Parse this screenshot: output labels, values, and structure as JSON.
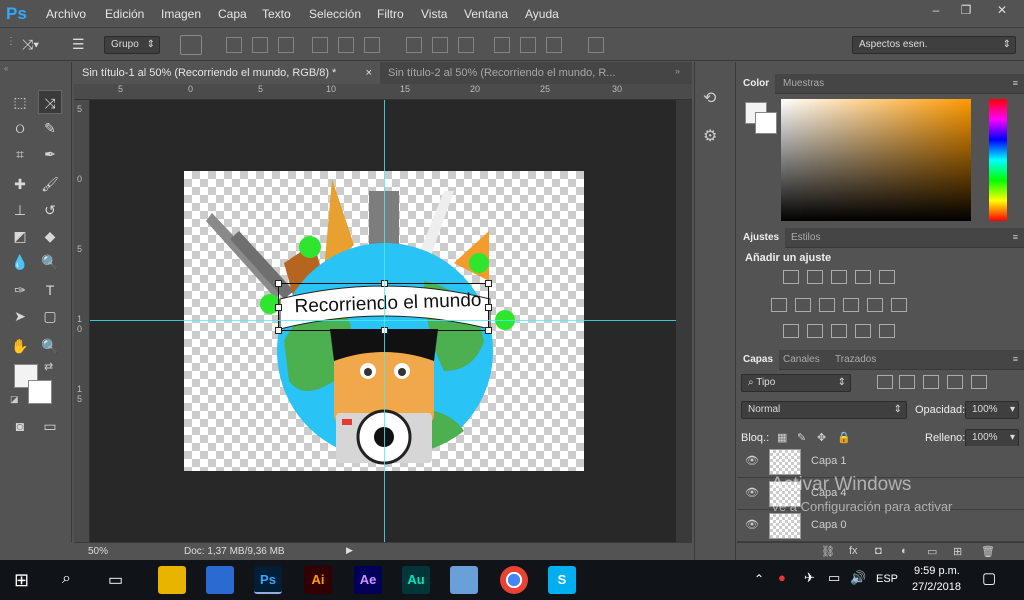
{
  "app": {
    "logo": "Ps"
  },
  "menu": [
    "Archivo",
    "Edición",
    "Imagen",
    "Capa",
    "Texto",
    "Selección",
    "Filtro",
    "Vista",
    "Ventana",
    "Ayuda"
  ],
  "options": {
    "auto_select_value": "Grupo",
    "workspace": "Aspectos esen."
  },
  "tabs": [
    {
      "label": "Sin título-1 al 50% (Recorriendo el mundo, RGB/8) *",
      "close": "×"
    },
    {
      "label": "Sin título-2 al 50% (Recorriendo el mundo, R...",
      "close": ""
    }
  ],
  "ruler": {
    "top": [
      "5",
      "0",
      "5",
      "10",
      "15",
      "20",
      "25",
      "30"
    ],
    "left": [
      "5",
      "0",
      "5",
      "1 0",
      "1 5"
    ]
  },
  "status": {
    "zoom": "50%",
    "doc": "Doc: 1,37 MB/9,36 MB"
  },
  "artwork": {
    "banner_text": "Recorriendo el mundo"
  },
  "color_panel": {
    "tabs": [
      "Color",
      "Muestras"
    ]
  },
  "adjust_panel": {
    "tabs": [
      "Ajustes",
      "Estilos"
    ],
    "title": "Añadir un ajuste"
  },
  "layers_panel": {
    "tabs": [
      "Capas",
      "Canales",
      "Trazados"
    ],
    "filter": "Tipo",
    "blend_mode": "Normal",
    "opacity_label": "Opacidad:",
    "opacity": "100%",
    "lock_label": "Bloq.:",
    "fill_label": "Relleno:",
    "fill": "100%",
    "layers": [
      {
        "name": "Capa 1"
      },
      {
        "name": "Capa 4"
      },
      {
        "name": "Capa 0"
      }
    ]
  },
  "watermark": {
    "title": "Activar Windows",
    "subtitle": "Ve a Configuración para activar"
  },
  "taskbar": {
    "apps": [
      "Ps",
      "Ai",
      "Ae",
      "Au"
    ],
    "lang": "ESP",
    "time": "9:59 p.m.",
    "date": "27/2/2018"
  },
  "colors": {
    "accent": "#31a8ff",
    "guide": "#3ef0ff",
    "earth_ocean": "#29c4f5",
    "earth_land": "#4caf50"
  }
}
